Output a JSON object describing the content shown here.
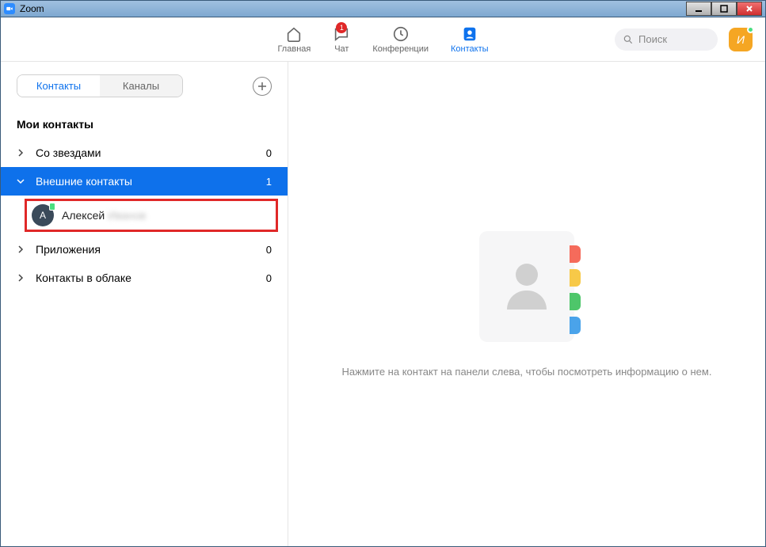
{
  "window": {
    "title": "Zoom"
  },
  "nav": {
    "home": "Главная",
    "chat": "Чат",
    "chat_badge": "1",
    "meetings": "Конференции",
    "contacts": "Контакты"
  },
  "search": {
    "placeholder": "Поиск"
  },
  "avatar": {
    "initial": "И"
  },
  "subtabs": {
    "contacts": "Контакты",
    "channels": "Каналы"
  },
  "sidebar": {
    "section_title": "Мои контакты",
    "groups": {
      "starred": {
        "label": "Со звездами",
        "count": "0"
      },
      "external": {
        "label": "Внешние контакты",
        "count": "1"
      },
      "apps": {
        "label": "Приложения",
        "count": "0"
      },
      "cloud": {
        "label": "Контакты в облаке",
        "count": "0"
      }
    },
    "contact": {
      "initial": "А",
      "name": "Алексей",
      "name_hidden": "Иванов"
    }
  },
  "empty": {
    "text": "Нажмите на контакт на панели слева, чтобы посмотреть информацию о нем."
  }
}
